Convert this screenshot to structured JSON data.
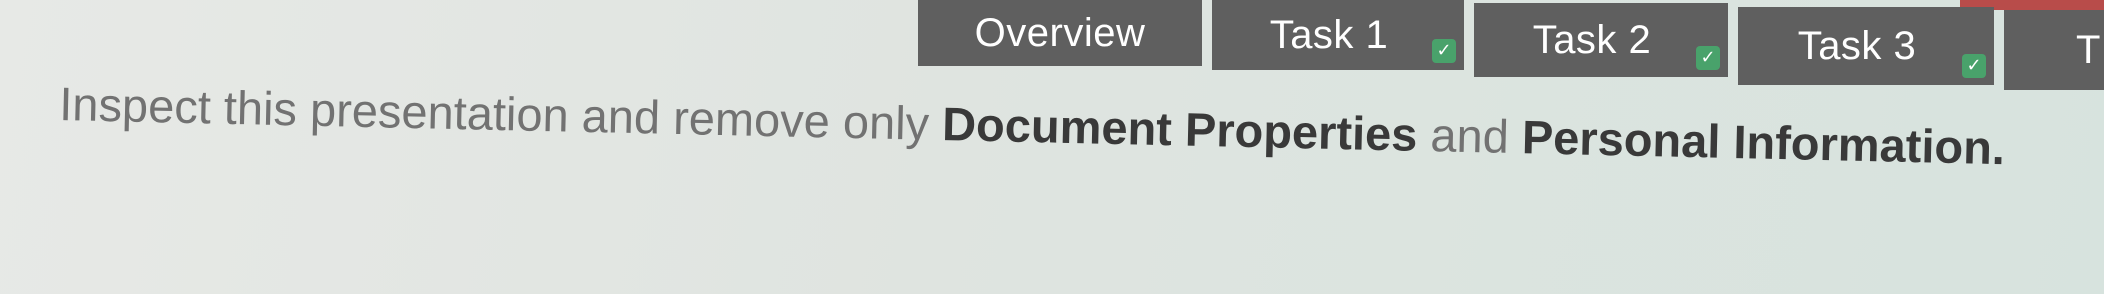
{
  "tabs": [
    {
      "label": "Overview",
      "completed": false
    },
    {
      "label": "Task 1",
      "completed": true
    },
    {
      "label": "Task 2",
      "completed": true
    },
    {
      "label": "Task 3",
      "completed": true
    },
    {
      "label": "T",
      "completed": false
    }
  ],
  "instruction": {
    "part1": "Inspect this presentation and remove only ",
    "bold1": "Document Properties",
    "part2": " and ",
    "bold2": "Personal Information",
    "part3": "."
  },
  "icons": {
    "completed": "check-icon"
  },
  "colors": {
    "tab_background": "#5f5f5f",
    "check_green": "#49a26b",
    "accent_red": "#b84c4a"
  }
}
